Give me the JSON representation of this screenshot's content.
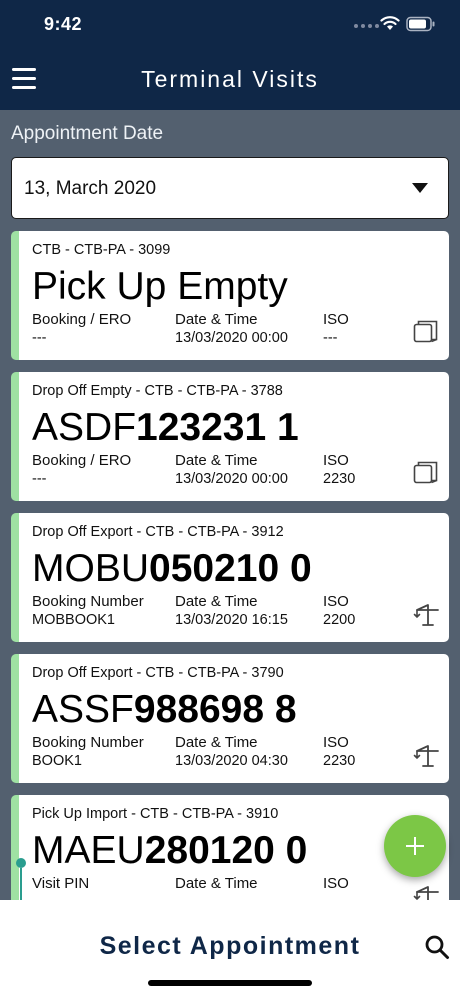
{
  "status": {
    "time": "9:42"
  },
  "header": {
    "title": "Terminal Visits"
  },
  "filter": {
    "label": "Appointment Date",
    "date": "13, March 2020"
  },
  "cards": [
    {
      "sub": "CTB - CTB-PA - 3099",
      "main_prefix": "Pick Up Empty",
      "main_number": "",
      "col1_header": "Booking / ERO",
      "col1_value": "---",
      "col2_header": "Date & Time",
      "col2_value": "13/03/2020 00:00",
      "col3_header": "ISO",
      "col3_value": "---",
      "icon": "container-icon"
    },
    {
      "sub": "Drop Off Empty - CTB - CTB-PA - 3788",
      "main_prefix": "ASDF",
      "main_number": "123231 1",
      "col1_header": "Booking / ERO",
      "col1_value": "---",
      "col2_header": "Date & Time",
      "col2_value": "13/03/2020 00:00",
      "col3_header": "ISO",
      "col3_value": "2230",
      "icon": "container-icon"
    },
    {
      "sub": "Drop Off Export - CTB - CTB-PA - 3912",
      "main_prefix": "MOBU",
      "main_number": "050210 0",
      "col1_header": "Booking Number",
      "col1_value": "MOBBOOK1",
      "col2_header": "Date & Time",
      "col2_value": "13/03/2020 16:15",
      "col3_header": "ISO",
      "col3_value": "2200",
      "icon": "crane-icon"
    },
    {
      "sub": "Drop Off Export - CTB - CTB-PA - 3790",
      "main_prefix": "ASSF",
      "main_number": "988698 8",
      "col1_header": "Booking Number",
      "col1_value": "BOOK1",
      "col2_header": "Date & Time",
      "col2_value": "13/03/2020 04:30",
      "col3_header": "ISO",
      "col3_value": "2230",
      "icon": "crane-icon"
    },
    {
      "sub": "Pick Up Import - CTB - CTB-PA - 3910",
      "main_prefix": "MAEU",
      "main_number": "280120 0",
      "col1_header": "Visit PIN",
      "col1_value": "",
      "col2_header": "Date & Time",
      "col2_value": "",
      "col3_header": "ISO",
      "col3_value": "",
      "icon": "crane-icon"
    }
  ],
  "fab": {
    "icon": "plus-icon"
  },
  "bottom": {
    "action_label": "Select Appointment",
    "search_icon": "search-icon"
  },
  "colors": {
    "header": "#0f2747",
    "content_bg": "#53606f",
    "card_accent": "#9fe1a3",
    "fab": "#7cc746"
  }
}
